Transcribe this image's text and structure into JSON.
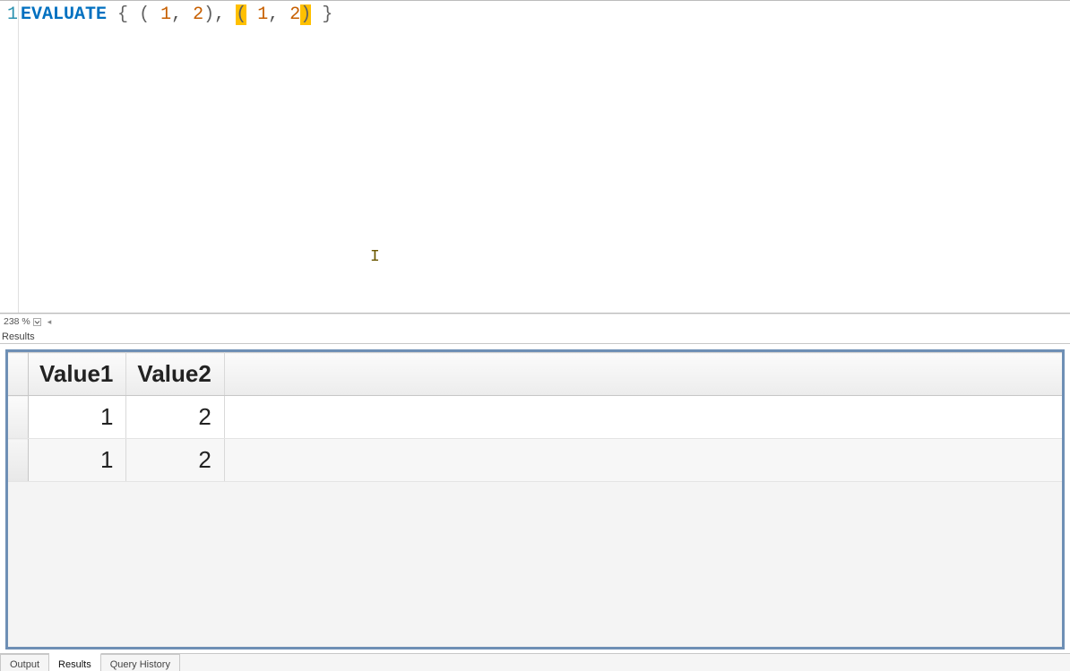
{
  "editor": {
    "line_number": "1",
    "tokens": {
      "kw": "EVALUATE",
      "sp": " ",
      "lbrace": "{",
      "lpar": "(",
      "num1": "1",
      "comma": ",",
      "num2": "2",
      "rpar": ")",
      "rbrace": "}"
    },
    "zoom_label": "238 %",
    "caret_glyph": "I"
  },
  "results": {
    "panel_title": "Results",
    "columns": [
      "Value1",
      "Value2"
    ],
    "rows": [
      [
        "1",
        "2"
      ],
      [
        "1",
        "2"
      ]
    ]
  },
  "tabs": {
    "items": [
      "Output",
      "Results",
      "Query History"
    ],
    "active_index": 1
  }
}
